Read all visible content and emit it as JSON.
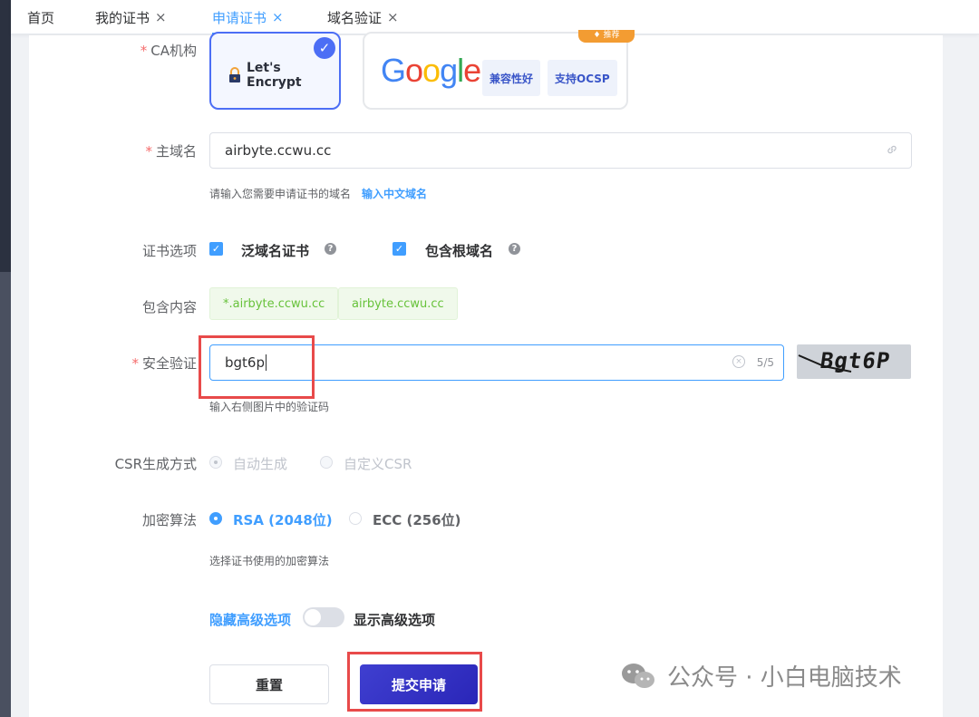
{
  "tabs": [
    {
      "label": "首页",
      "closable": false,
      "active": false
    },
    {
      "label": "我的证书",
      "closable": true,
      "active": false
    },
    {
      "label": "申请证书",
      "closable": true,
      "active": true
    },
    {
      "label": "域名验证",
      "closable": true,
      "active": false
    }
  ],
  "close_glyph": "×",
  "form": {
    "ca": {
      "label": "CA机构",
      "options": [
        {
          "name": "Let's Encrypt",
          "selected": true
        },
        {
          "name": "Google",
          "selected": false,
          "tags": [
            "兼容性好",
            "支持OCSP"
          ],
          "promo": "♦ 推荐"
        }
      ]
    },
    "domain": {
      "label": "主域名",
      "value": "airbyte.ccwu.cc",
      "help": "请输入您需要申请证书的域名",
      "help_link": "输入中文域名"
    },
    "cert_options": {
      "label": "证书选项",
      "items": [
        {
          "label": "泛域名证书",
          "checked": true
        },
        {
          "label": "包含根域名",
          "checked": true
        }
      ]
    },
    "includes": {
      "label": "包含内容",
      "chips": [
        "*.airbyte.ccwu.cc",
        "airbyte.ccwu.cc"
      ]
    },
    "captcha": {
      "label": "安全验证",
      "value": "bgt6p",
      "counter": "5/5",
      "image_text": "Bgt6P",
      "help": "输入右侧图片中的验证码"
    },
    "csr": {
      "label": "CSR生成方式",
      "options": [
        "自动生成",
        "自定义CSR"
      ]
    },
    "algorithm": {
      "label": "加密算法",
      "options": [
        {
          "label": "RSA (2048位)",
          "checked": true
        },
        {
          "label": "ECC (256位)",
          "checked": false
        }
      ],
      "help": "选择证书使用的加密算法"
    },
    "advanced": {
      "hide_label": "隐藏高级选项",
      "show_label": "显示高级选项",
      "on": false
    },
    "buttons": {
      "reset": "重置",
      "submit": "提交申请"
    }
  },
  "watermark": "公众号 · 小白电脑技术",
  "colors": {
    "primary": "#409eff",
    "brand_indigo": "#4c6ef5",
    "highlight_red": "#e84a4a",
    "success": "#67c23a"
  }
}
